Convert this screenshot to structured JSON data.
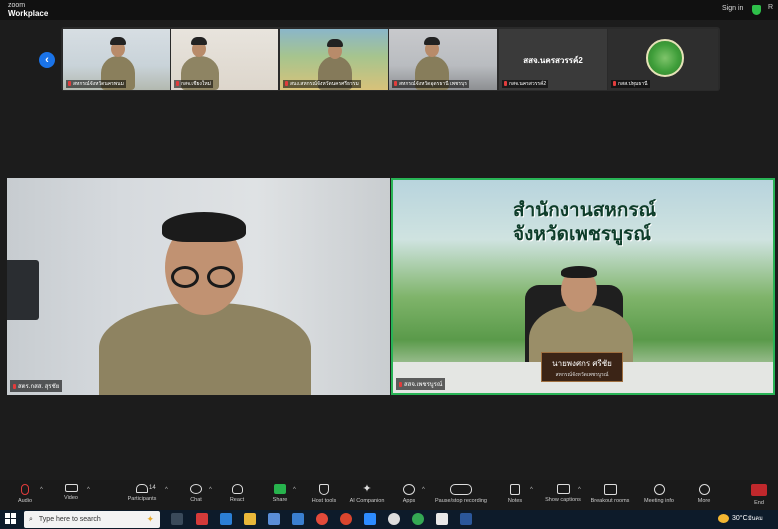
{
  "app": {
    "logo_top": "zoom",
    "logo_bottom": "Workplace",
    "sign_in": "Sign in",
    "extra": "R"
  },
  "gallery": {
    "thumbs": [
      {
        "label": "สหกรณ์จังหวัดนครพนม"
      },
      {
        "label": "กสจ.เชียงใหม่"
      },
      {
        "label": "สนง.สหกรณ์จังหวัดนครศรีธรรม"
      },
      {
        "label": "สหกรณ์จังหวัดอุดรธานี เพชรบุร"
      },
      {
        "label": "กสจ.นครสวรรค์2",
        "center_name": "สสจ.นครสวรรค์2"
      },
      {
        "label": "กสส.ปทุมธานี"
      }
    ]
  },
  "main": {
    "left_name": "สตร.กสส. สุรชัย",
    "right_name": "สสจ.เพชรบูรณ์",
    "banner_line1": "สำนักงานสหกรณ์",
    "banner_line2": "จังหวัดเพชรบูรณ์",
    "nameplate_name": "นายพงศกร ศรีชัย",
    "nameplate_title": "สหกรณ์จังหวัดเพชรบูรณ์"
  },
  "toolbar": {
    "audio": "Audio",
    "video": "Video",
    "participants": "Participants",
    "participants_count": "14",
    "chat": "Chat",
    "react": "React",
    "share": "Share",
    "host_tools": "Host tools",
    "ai_companion": "AI Companion",
    "apps": "Apps",
    "pause_recording": "Pause/stop recording",
    "notes": "Notes",
    "captions": "Show captions",
    "breakout": "Breakout rooms",
    "meeting_info": "Meeting info",
    "more": "More",
    "end": "End"
  },
  "taskbar": {
    "search_placeholder": "Type here to search",
    "temperature": "30°C",
    "date": "มีนคม"
  },
  "colors": {
    "active_speaker": "#29b456",
    "end_button": "#c0282c",
    "share_button": "#27b34d",
    "nav_button": "#1a73e8"
  }
}
